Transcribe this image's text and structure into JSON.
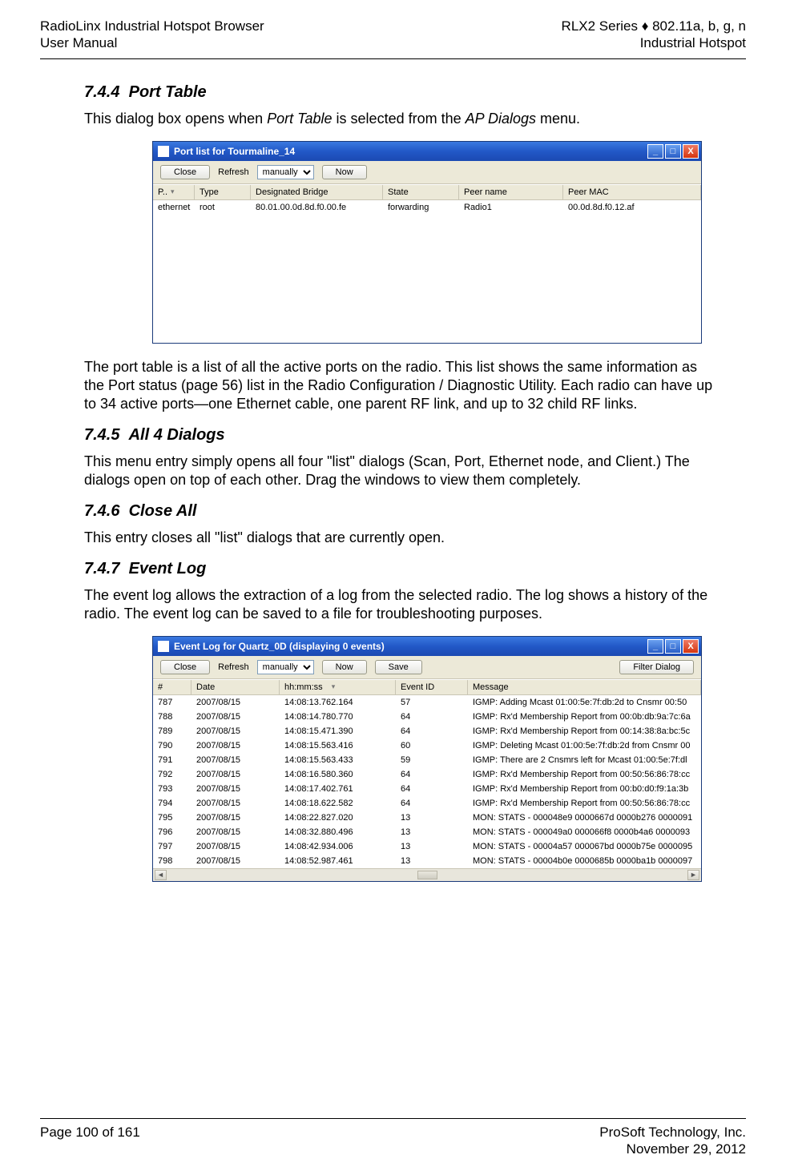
{
  "header": {
    "left1": "RadioLinx Industrial Hotspot Browser",
    "left2": "User Manual",
    "right1": "RLX2 Series ♦ 802.11a, b, g, n",
    "right2": "Industrial Hotspot"
  },
  "s744": {
    "num": "7.4.4",
    "title": "Port Table",
    "intro_a": "This dialog box opens when ",
    "intro_b": "Port Table",
    "intro_c": " is selected from the ",
    "intro_d": "AP Dialogs",
    "intro_e": " menu.",
    "after": "The port table is a list of all the active ports on the radio. This list shows the same information as the Port status (page 56) list in the Radio Configuration / Diagnostic Utility. Each radio can have up to 34 active ports—one Ethernet cable, one parent RF link, and up to 32 child RF links."
  },
  "portwin": {
    "title": "Port list for Tourmaline_14",
    "close": "Close",
    "refresh": "Refresh",
    "sel": "manually",
    "now": "Now",
    "cols": {
      "c1": "P..",
      "c2": "Type",
      "c3": "Designated Bridge",
      "c4": "State",
      "c5": "Peer name",
      "c6": "Peer MAC"
    },
    "row": {
      "c1": "ethernet",
      "c2": "root",
      "c3": "80.01.00.0d.8d.f0.00.fe",
      "c4": "forwarding",
      "c5": "Radio1",
      "c6": "00.0d.8d.f0.12.af"
    }
  },
  "s745": {
    "num": "7.4.5",
    "title": "All 4 Dialogs",
    "body": "This menu entry simply opens all four \"list\" dialogs (Scan, Port, Ethernet node, and Client.) The dialogs open on top of each other.  Drag the windows to view them completely."
  },
  "s746": {
    "num": "7.4.6",
    "title": "Close All",
    "body": "This entry closes all \"list\" dialogs that are currently open."
  },
  "s747": {
    "num": "7.4.7",
    "title": "Event Log",
    "body": "The event log allows the extraction of a log from the selected radio. The log shows a history of the radio. The event log can be saved to a file for troubleshooting purposes."
  },
  "evwin": {
    "title": "Event Log for Quartz_0D (displaying 0 events)",
    "close": "Close",
    "refresh": "Refresh",
    "sel": "manually",
    "now": "Now",
    "save": "Save",
    "filter": "Filter Dialog",
    "cols": {
      "c1": "#",
      "c2": "Date",
      "c3": "hh:mm:ss",
      "c4": "Event ID",
      "c5": "Message"
    },
    "rows": [
      {
        "n": "787",
        "d": "2007/08/15",
        "t": "14:08:13.762.164",
        "e": "57",
        "m": "IGMP: Adding Mcast 01:00:5e:7f:db:2d to Cnsmr 00:50"
      },
      {
        "n": "788",
        "d": "2007/08/15",
        "t": "14:08:14.780.770",
        "e": "64",
        "m": "IGMP: Rx'd Membership Report from 00:0b:db:9a:7c:6a"
      },
      {
        "n": "789",
        "d": "2007/08/15",
        "t": "14:08:15.471.390",
        "e": "64",
        "m": "IGMP: Rx'd Membership Report from 00:14:38:8a:bc:5c"
      },
      {
        "n": "790",
        "d": "2007/08/15",
        "t": "14:08:15.563.416",
        "e": "60",
        "m": "IGMP: Deleting Mcast 01:00:5e:7f:db:2d from Cnsmr 00"
      },
      {
        "n": "791",
        "d": "2007/08/15",
        "t": "14:08:15.563.433",
        "e": "59",
        "m": "IGMP: There are 2 Cnsmrs left for Mcast 01:00:5e:7f:dl"
      },
      {
        "n": "792",
        "d": "2007/08/15",
        "t": "14:08:16.580.360",
        "e": "64",
        "m": "IGMP: Rx'd Membership Report from 00:50:56:86:78:cc"
      },
      {
        "n": "793",
        "d": "2007/08/15",
        "t": "14:08:17.402.761",
        "e": "64",
        "m": "IGMP: Rx'd Membership Report from 00:b0:d0:f9:1a:3b"
      },
      {
        "n": "794",
        "d": "2007/08/15",
        "t": "14:08:18.622.582",
        "e": "64",
        "m": "IGMP: Rx'd Membership Report from 00:50:56:86:78:cc"
      },
      {
        "n": "795",
        "d": "2007/08/15",
        "t": "14:08:22.827.020",
        "e": "13",
        "m": "MON: STATS - 000048e9 0000667d 0000b276 0000091"
      },
      {
        "n": "796",
        "d": "2007/08/15",
        "t": "14:08:32.880.496",
        "e": "13",
        "m": "MON: STATS - 000049a0 000066f8 0000b4a6 0000093"
      },
      {
        "n": "797",
        "d": "2007/08/15",
        "t": "14:08:42.934.006",
        "e": "13",
        "m": "MON: STATS - 00004a57 000067bd 0000b75e 0000095"
      },
      {
        "n": "798",
        "d": "2007/08/15",
        "t": "14:08:52.987.461",
        "e": "13",
        "m": "MON: STATS - 00004b0e 0000685b 0000ba1b 0000097"
      }
    ]
  },
  "footer": {
    "left": "Page 100 of 161",
    "right1": "ProSoft Technology, Inc.",
    "right2": "November 29, 2012"
  },
  "glyph": {
    "min": "_",
    "max": "□",
    "x": "X",
    "left": "◄",
    "right": "►",
    "down": "▾"
  }
}
